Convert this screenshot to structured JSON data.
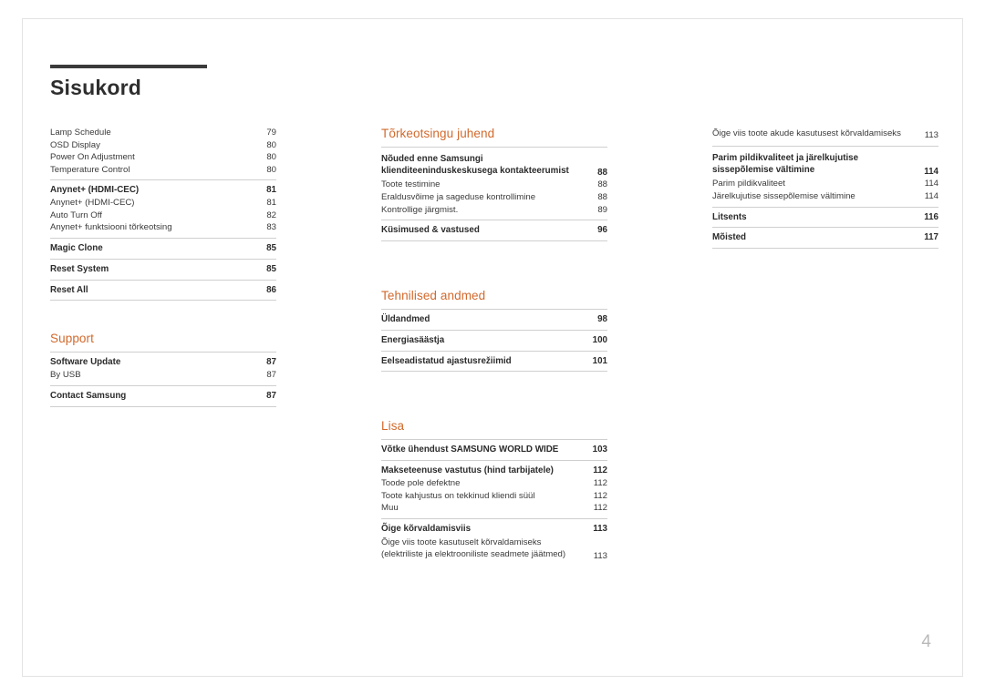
{
  "document": {
    "title": "Sisukord",
    "page_number": "4"
  },
  "column1": {
    "entries": [
      {
        "label": "Lamp Schedule",
        "page": "79",
        "bold": false
      },
      {
        "label": "OSD Display",
        "page": "80",
        "bold": false
      },
      {
        "label": "Power On Adjustment",
        "page": "80",
        "bold": false
      },
      {
        "label": "Temperature Control",
        "page": "80",
        "bold": false
      },
      {
        "label": "Anynet+ (HDMI-CEC)",
        "page": "81",
        "bold": true
      },
      {
        "label": "Anynet+ (HDMI-CEC)",
        "page": "81",
        "bold": false
      },
      {
        "label": "Auto Turn Off",
        "page": "82",
        "bold": false
      },
      {
        "label": "Anynet+ funktsiooni tõrkeotsing",
        "page": "83",
        "bold": false
      },
      {
        "label": "Magic Clone",
        "page": "85",
        "bold": true
      },
      {
        "label": "Reset System",
        "page": "85",
        "bold": true
      },
      {
        "label": "Reset All",
        "page": "86",
        "bold": true
      }
    ],
    "support_head": "Support",
    "support_entries": [
      {
        "label": "Software Update",
        "page": "87",
        "bold": true
      },
      {
        "label": "By USB",
        "page": "87",
        "bold": false
      },
      {
        "label": "Contact Samsung",
        "page": "87",
        "bold": true
      }
    ]
  },
  "column2": {
    "troubleshoot_head": "Tõrkeotsingu juhend",
    "troubleshoot_entries": [
      {
        "label": "Nõuded enne Samsungi klienditeeninduskeskusega kontakteerumist",
        "page": "88",
        "bold": true
      },
      {
        "label": "Toote testimine",
        "page": "88",
        "bold": false
      },
      {
        "label": "Eraldusvõime ja sageduse kontrollimine",
        "page": "88",
        "bold": false
      },
      {
        "label": "Kontrollige järgmist.",
        "page": "89",
        "bold": false
      },
      {
        "label": "Küsimused & vastused",
        "page": "96",
        "bold": true
      }
    ],
    "specs_head": "Tehnilised andmed",
    "specs_entries": [
      {
        "label": "Üldandmed",
        "page": "98",
        "bold": true
      },
      {
        "label": "Energiasäästja",
        "page": "100",
        "bold": true
      },
      {
        "label": "Eelseadistatud ajastusrežiimid",
        "page": "101",
        "bold": true
      }
    ],
    "appendix_head": "Lisa",
    "appendix_entries": [
      {
        "label": "Võtke ühendust SAMSUNG WORLD WIDE",
        "page": "103",
        "bold": true
      },
      {
        "label": "Makseteenuse vastutus (hind tarbijatele)",
        "page": "112",
        "bold": true
      },
      {
        "label": "Toode pole defektne",
        "page": "112",
        "bold": false
      },
      {
        "label": "Toote kahjustus on tekkinud kliendi süül",
        "page": "112",
        "bold": false
      },
      {
        "label": "Muu",
        "page": "112",
        "bold": false
      },
      {
        "label": "Õige kõrvaldamisviis",
        "page": "113",
        "bold": true
      },
      {
        "label": "Õige viis toote kasutuselt kõrvaldamiseks (elektriliste ja elektrooniliste seadmete jäätmed)",
        "page": "113",
        "bold": false
      }
    ]
  },
  "column3": {
    "entries": [
      {
        "label": "Õige viis toote akude kasutusest kõrvaldamiseks",
        "page": "113",
        "bold": false
      },
      {
        "label": "Parim pildikvaliteet ja järelkujutise sissepõlemise vältimine",
        "page": "114",
        "bold": true
      },
      {
        "label": "Parim pildikvaliteet",
        "page": "114",
        "bold": false
      },
      {
        "label": "Järelkujutise sissepõlemise vältimine",
        "page": "114",
        "bold": false
      },
      {
        "label": "Litsents",
        "page": "116",
        "bold": true
      },
      {
        "label": "Mõisted",
        "page": "117",
        "bold": true
      }
    ]
  }
}
